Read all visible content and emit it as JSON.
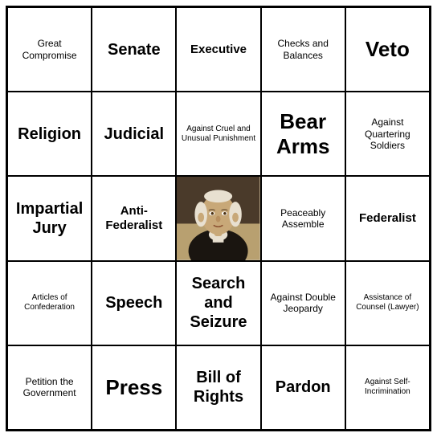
{
  "board": {
    "cells": [
      {
        "id": "r0c0",
        "text": "Great Compromise",
        "size": "sm"
      },
      {
        "id": "r0c1",
        "text": "Senate",
        "size": "lg"
      },
      {
        "id": "r0c2",
        "text": "Executive",
        "size": "md"
      },
      {
        "id": "r0c3",
        "text": "Checks and Balances",
        "size": "sm"
      },
      {
        "id": "r0c4",
        "text": "Veto",
        "size": "xl"
      },
      {
        "id": "r1c0",
        "text": "Religion",
        "size": "lg"
      },
      {
        "id": "r1c1",
        "text": "Judicial",
        "size": "lg"
      },
      {
        "id": "r1c2",
        "text": "Against Cruel and Unusual Punishment",
        "size": "xs"
      },
      {
        "id": "r1c3",
        "text": "Bear Arms",
        "size": "xl"
      },
      {
        "id": "r1c4",
        "text": "Against Quartering Soldiers",
        "size": "sm"
      },
      {
        "id": "r2c0",
        "text": "Impartial Jury",
        "size": "lg"
      },
      {
        "id": "r2c1",
        "text": "Anti-Federalist",
        "size": "md"
      },
      {
        "id": "r2c2",
        "text": "__PORTRAIT__",
        "size": "portrait"
      },
      {
        "id": "r2c3",
        "text": "Peaceably Assemble",
        "size": "sm"
      },
      {
        "id": "r2c4",
        "text": "Federalist",
        "size": "md"
      },
      {
        "id": "r3c0",
        "text": "Articles of Confederation",
        "size": "xs"
      },
      {
        "id": "r3c1",
        "text": "Speech",
        "size": "lg"
      },
      {
        "id": "r3c2",
        "text": "Search and Seizure",
        "size": "lg"
      },
      {
        "id": "r3c3",
        "text": "Against Double Jeopardy",
        "size": "sm"
      },
      {
        "id": "r3c4",
        "text": "Assistance of Counsel (Lawyer)",
        "size": "xs"
      },
      {
        "id": "r4c0",
        "text": "Petition the Government",
        "size": "sm"
      },
      {
        "id": "r4c1",
        "text": "Press",
        "size": "xl"
      },
      {
        "id": "r4c2",
        "text": "Bill of Rights",
        "size": "lg"
      },
      {
        "id": "r4c3",
        "text": "Pardon",
        "size": "lg"
      },
      {
        "id": "r4c4",
        "text": "Against Self-Incrimination",
        "size": "xs"
      }
    ]
  }
}
